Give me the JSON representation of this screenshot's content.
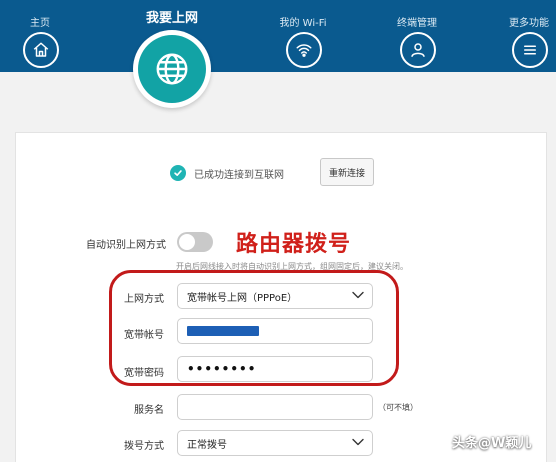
{
  "nav": {
    "home_label": "主页",
    "internet_label": "我要上网",
    "wifi_label": "我的 Wi-Fi",
    "terminal_label": "终端管理",
    "more_label": "更多功能"
  },
  "status": {
    "text": "已成功连接到互联网",
    "reconnect_label": "重新连接"
  },
  "auto_detect": {
    "label": "自动识别上网方式",
    "enabled": false,
    "hint": "开启后网线接入时将自动识别上网方式，组网固定后，建议关闭。"
  },
  "annotation": "路由器拨号",
  "form": {
    "access_mode_label": "上网方式",
    "access_mode_value": "宽带帐号上网（PPPoE）",
    "account_label": "宽带帐号",
    "password_label": "宽带密码",
    "password_value": "••••••••",
    "service_label": "服务名",
    "service_note": "（可不填）",
    "dial_mode_label": "拨号方式",
    "dial_mode_value": "正常拨号"
  },
  "watermark": "头条@W颖儿",
  "colors": {
    "nav_bg": "#0a5a8f",
    "active_accent": "#12a3a5",
    "annotation_red": "#d0201a",
    "highlight_border": "#c21a1a"
  },
  "icons": {
    "home": "home-icon",
    "internet": "globe-icon",
    "wifi": "wifi-icon",
    "terminal": "user-icon",
    "more": "menu-icon",
    "status": "check-circle-icon"
  }
}
